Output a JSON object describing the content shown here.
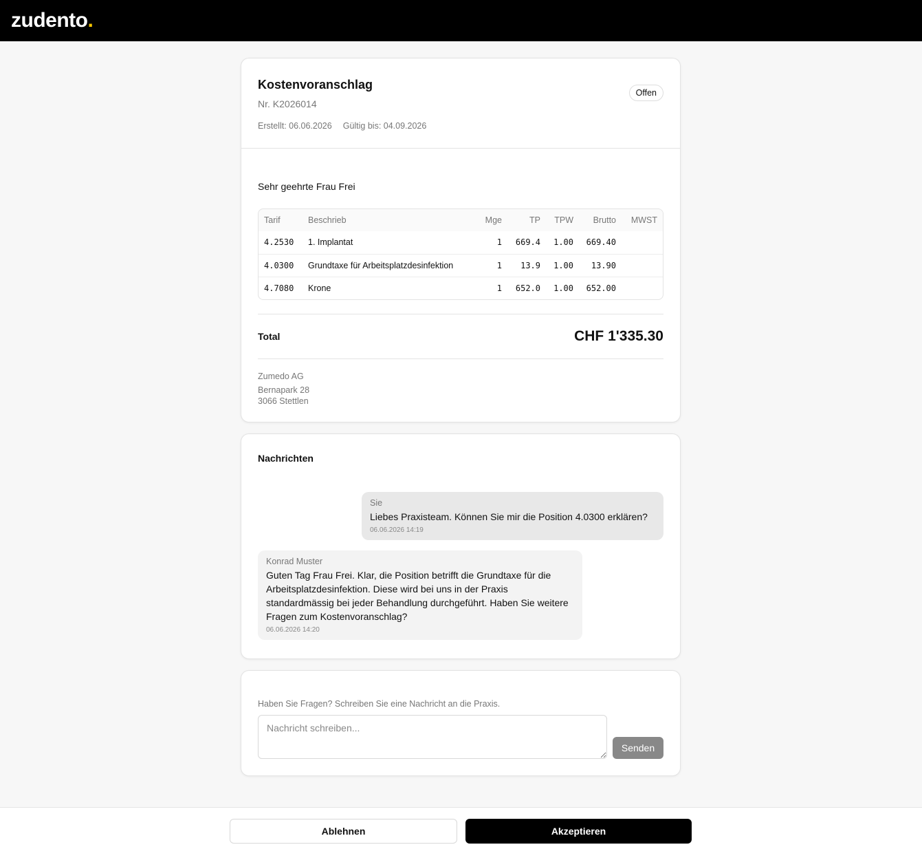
{
  "header": {
    "logo_text": "zudento",
    "logo_dot": ".",
    "logo_dot_color": "#f5c400"
  },
  "quote": {
    "title": "Kostenvoranschlag",
    "number": "Nr. K2026014",
    "created": "Erstellt: 06.06.2026",
    "valid_until": "Gültig bis: 04.09.2026",
    "status": "Offen",
    "salutation": "Sehr geehrte Frau Frei",
    "table": {
      "headers": [
        "Tarif",
        "Beschrieb",
        "Mge",
        "TP",
        "TPW",
        "Brutto",
        "MWST"
      ],
      "rows": [
        {
          "tarif": "4.2530",
          "beschrieb": "1. Implantat",
          "mge": "1",
          "tp": "669.4",
          "tpw": "1.00",
          "brutto": "669.40",
          "mwst": ""
        },
        {
          "tarif": "4.0300",
          "beschrieb": "Grundtaxe für Arbeitsplatzdesinfektion",
          "mge": "1",
          "tp": "13.9",
          "tpw": "1.00",
          "brutto": "13.90",
          "mwst": ""
        },
        {
          "tarif": "4.7080",
          "beschrieb": "Krone",
          "mge": "1",
          "tp": "652.0",
          "tpw": "1.00",
          "brutto": "652.00",
          "mwst": ""
        }
      ]
    },
    "total_label": "Total",
    "total_value": "CHF 1'335.30",
    "address": {
      "company": "Zumedo AG",
      "street": "Bernapark 28",
      "city": "3066 Stettlen"
    }
  },
  "messages": {
    "title": "Nachrichten",
    "items": [
      {
        "author": "Sie",
        "text": "Liebes Praxisteam. Können Sie mir die Position 4.0300 erklären?",
        "time": "06.06.2026 14:19"
      },
      {
        "author": "Konrad Muster",
        "text": "Guten Tag Frau Frei. Klar, die Position betrifft die Grundtaxe für die Arbeitsplatzdesinfektion. Diese wird bei uns in der Praxis standardmässig bei jeder Behandlung durchgeführt. Haben Sie weitere Fragen zum Kostenvoranschlag?",
        "time": "06.06.2026 14:20"
      }
    ]
  },
  "compose": {
    "hint": "Haben Sie Fragen? Schreiben Sie eine Nachricht an die Praxis.",
    "placeholder": "Nachricht schreiben...",
    "send_label": "Senden"
  },
  "footer": {
    "decline_label": "Ablehnen",
    "accept_label": "Akzeptieren"
  }
}
